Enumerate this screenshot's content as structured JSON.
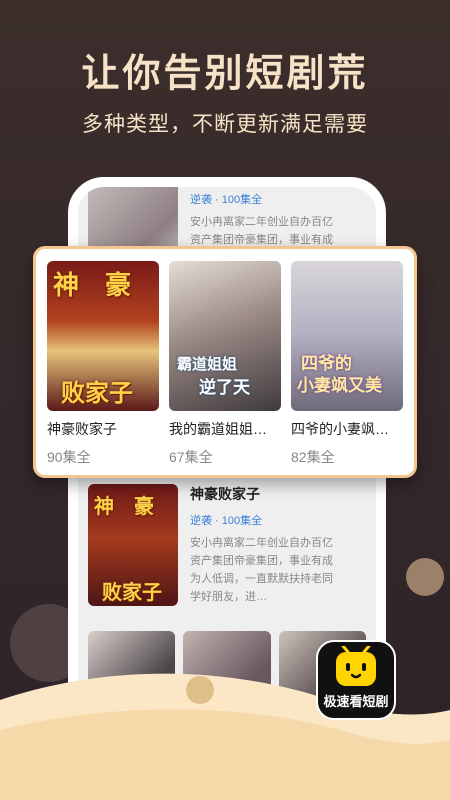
{
  "headline": "让你告别短剧荒",
  "subline": "多种类型，不断更新满足需要",
  "phone": {
    "top_item": {
      "meta": "逆袭 · 100集全",
      "desc_line1": "安小冉离家二年创业自办百亿",
      "desc_line2": "资产集团帝豪集团，事业有成"
    },
    "mid_item": {
      "title": "神豪败家子",
      "meta": "逆袭 · 100集全",
      "desc_line1": "安小冉离家二年创业自办百亿",
      "desc_line2": "资产集团帝豪集团，事业有成",
      "desc_line3": "为人低调，一直默默扶持老同",
      "desc_line4": "学好朋友，进…"
    }
  },
  "highlight": {
    "items": [
      {
        "title": "神豪败家子",
        "episodes": "90集全",
        "cover_top": "神　豪",
        "cover_bottom": "败家子"
      },
      {
        "title": "我的霸道姐姐…",
        "episodes": "67集全",
        "cover_top": "霸道姐姐",
        "cover_bottom": "逆了天"
      },
      {
        "title": "四爷的小妻飒…",
        "episodes": "82集全",
        "cover_top": "四爷的",
        "cover_bottom": "小妻飒又美"
      }
    ]
  },
  "app_badge": {
    "label": "极速看短剧"
  },
  "colors": {
    "accent": "#f6e2c6",
    "card_border": "#f2c68d",
    "link": "#3b7fd8",
    "badge": "#ffd400"
  }
}
